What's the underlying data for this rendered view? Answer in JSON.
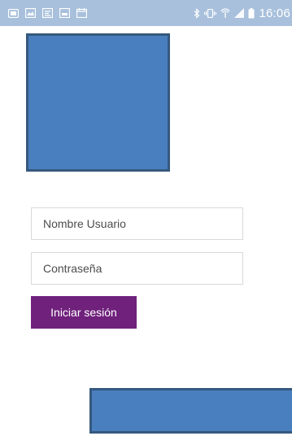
{
  "status_bar": {
    "time": "16:06",
    "left_icons": [
      "notification-icon",
      "gallery-icon",
      "wifi-tether-icon",
      "screenshot-icon",
      "calendar-icon"
    ],
    "right_icons": [
      "bluetooth-icon",
      "vibrate-icon",
      "hotspot-icon",
      "signal-icon",
      "battery-icon"
    ],
    "background_color": "#a8c0dc"
  },
  "login_form": {
    "username_placeholder": "Nombre Usuario",
    "password_placeholder": "Contraseña",
    "submit_label": "Iniciar sesión",
    "button_color": "#70217c"
  },
  "placeholder_color": "#4a7fbf"
}
